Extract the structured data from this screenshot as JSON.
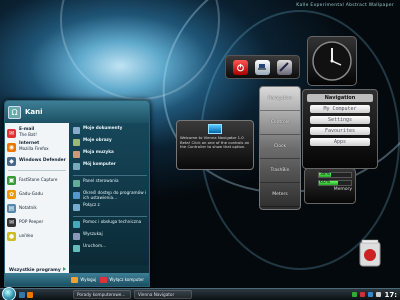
{
  "desktop": {
    "topbar_text": "Experimental Abstract Wallpaper",
    "topbar_prefix": "Kalle"
  },
  "start_menu": {
    "user": "Kani",
    "left_items": [
      {
        "title": "E-mail",
        "sub": "The Bat!",
        "color": "#d33",
        "glyph": "✉"
      },
      {
        "title": "Internet",
        "sub": "Mozilla Firefox",
        "color": "#e70",
        "glyph": "◉"
      },
      {
        "title": "Windows Defender",
        "sub": "",
        "color": "#468",
        "glyph": "◆"
      },
      {
        "title": "FastStone Capture",
        "sub": "",
        "color": "#393",
        "glyph": "▣"
      },
      {
        "title": "Gadu-Gadu",
        "sub": "",
        "color": "#e90",
        "glyph": "✿"
      },
      {
        "title": "Notatnik",
        "sub": "",
        "color": "#58a",
        "glyph": "▤"
      },
      {
        "title": "POP Peeper",
        "sub": "",
        "color": "#333",
        "glyph": "✉"
      },
      {
        "title": "uniVeo",
        "sub": "",
        "color": "#cb2",
        "glyph": "●"
      }
    ],
    "all_programs": "Wszystkie programy",
    "right_items": [
      {
        "text": "Moje dokumenty",
        "bold": true,
        "color": "#8ac"
      },
      {
        "text": "Moje obrazy",
        "bold": true,
        "color": "#9b7"
      },
      {
        "text": "Moja muzyka",
        "bold": true,
        "color": "#c97"
      },
      {
        "text": "Mój komputer",
        "bold": true,
        "color": "#7ab"
      },
      {
        "text": "Panel sterowania",
        "bold": false,
        "color": "#6a9"
      },
      {
        "text": "Określ dostęp do programów i ich ustawienia...",
        "bold": false,
        "color": "#59c"
      },
      {
        "text": "Połącz z",
        "bold": false,
        "color": "#7ac"
      },
      {
        "text": "Pomoc i obsługa techniczna",
        "bold": false,
        "color": "#4ab"
      },
      {
        "text": "Wyszukaj",
        "bold": false,
        "color": "#89b"
      },
      {
        "text": "Uruchom...",
        "bold": false,
        "color": "#6bb"
      }
    ],
    "logoff": "Wyloguj",
    "shutdown": "Wyłącz komputer"
  },
  "taskbar": {
    "tasks": [
      "Porady komputerowe...",
      "Vienna Navigator"
    ],
    "clock": "17:"
  },
  "gadgets": {
    "nav_buttons": [
      "Navigation",
      "Controls",
      "Clock",
      "TrashBin",
      "Meters"
    ],
    "nav_panel_title": "Navigation",
    "nav_panel_items": [
      "My Computer",
      "Settings",
      "Favourites",
      "Apps"
    ],
    "welcome_text": "Welcome to Vienna Navigator 1.0 Beta! Click on one of the controls on the Controller to show that option.",
    "meters": [
      {
        "label": "CPU",
        "value": 38
      },
      {
        "label": "Memory",
        "value": 60
      }
    ],
    "meter_cpu_pct": "38%",
    "meter_mem_pct": "60%",
    "meter_mem_label": "Memory"
  },
  "colors": {
    "accent": "#1f5577",
    "taskbar": "#0a1014",
    "start_right": "#16475a"
  }
}
